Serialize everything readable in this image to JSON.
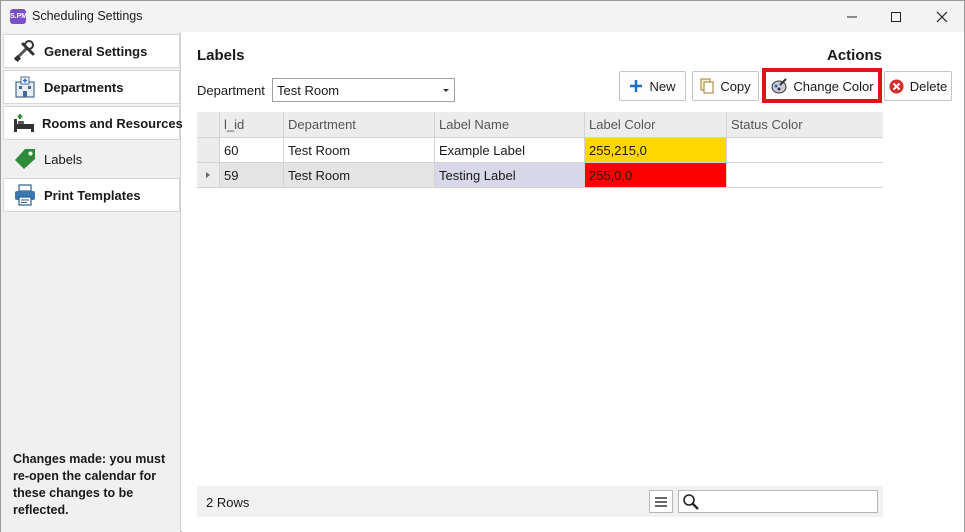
{
  "window": {
    "title": "Scheduling Settings",
    "app_icon_text": "S.PM",
    "controls": [
      "minimize-icon",
      "maximize-icon",
      "close-icon"
    ]
  },
  "sidebar": {
    "items": [
      {
        "label": "General Settings",
        "icon": "tools-icon",
        "active": false
      },
      {
        "label": "Departments",
        "icon": "hospital-icon",
        "active": false
      },
      {
        "label": "Rooms and Resources",
        "icon": "bed-icon",
        "active": false
      },
      {
        "label": "Labels",
        "icon": "tag-icon",
        "active": true
      },
      {
        "label": "Print Templates",
        "icon": "printer-icon",
        "active": false
      }
    ],
    "note": "Changes made: you must re-open the calendar for these changes to be reflected."
  },
  "main": {
    "labels_title": "Labels",
    "actions_title": "Actions",
    "department_label": "Department",
    "department_value": "Test Room",
    "buttons": {
      "new": "New",
      "copy": "Copy",
      "change_color": "Change Color",
      "delete": "Delete"
    },
    "grid": {
      "columns": [
        "l_id",
        "Department",
        "Label Name",
        "Label Color",
        "Status Color"
      ],
      "rows": [
        {
          "id": "60",
          "department": "Test Room",
          "label_name": "Example Label",
          "label_color": "255,215,0",
          "status_color": "",
          "color_hex": "#ffd700",
          "current": false
        },
        {
          "id": "59",
          "department": "Test Room",
          "label_name": "Testing Label",
          "label_color": "255,0,0",
          "status_color": "",
          "color_hex": "#ff0000",
          "current": true
        }
      ]
    },
    "footer": {
      "rows_count": "2 Rows",
      "search_value": ""
    }
  },
  "colors": {
    "highlight": "#e0121a",
    "new_icon": "#1f6fc5",
    "delete_icon": "#d32f2f",
    "labels_tag": "#2e8b3a"
  }
}
